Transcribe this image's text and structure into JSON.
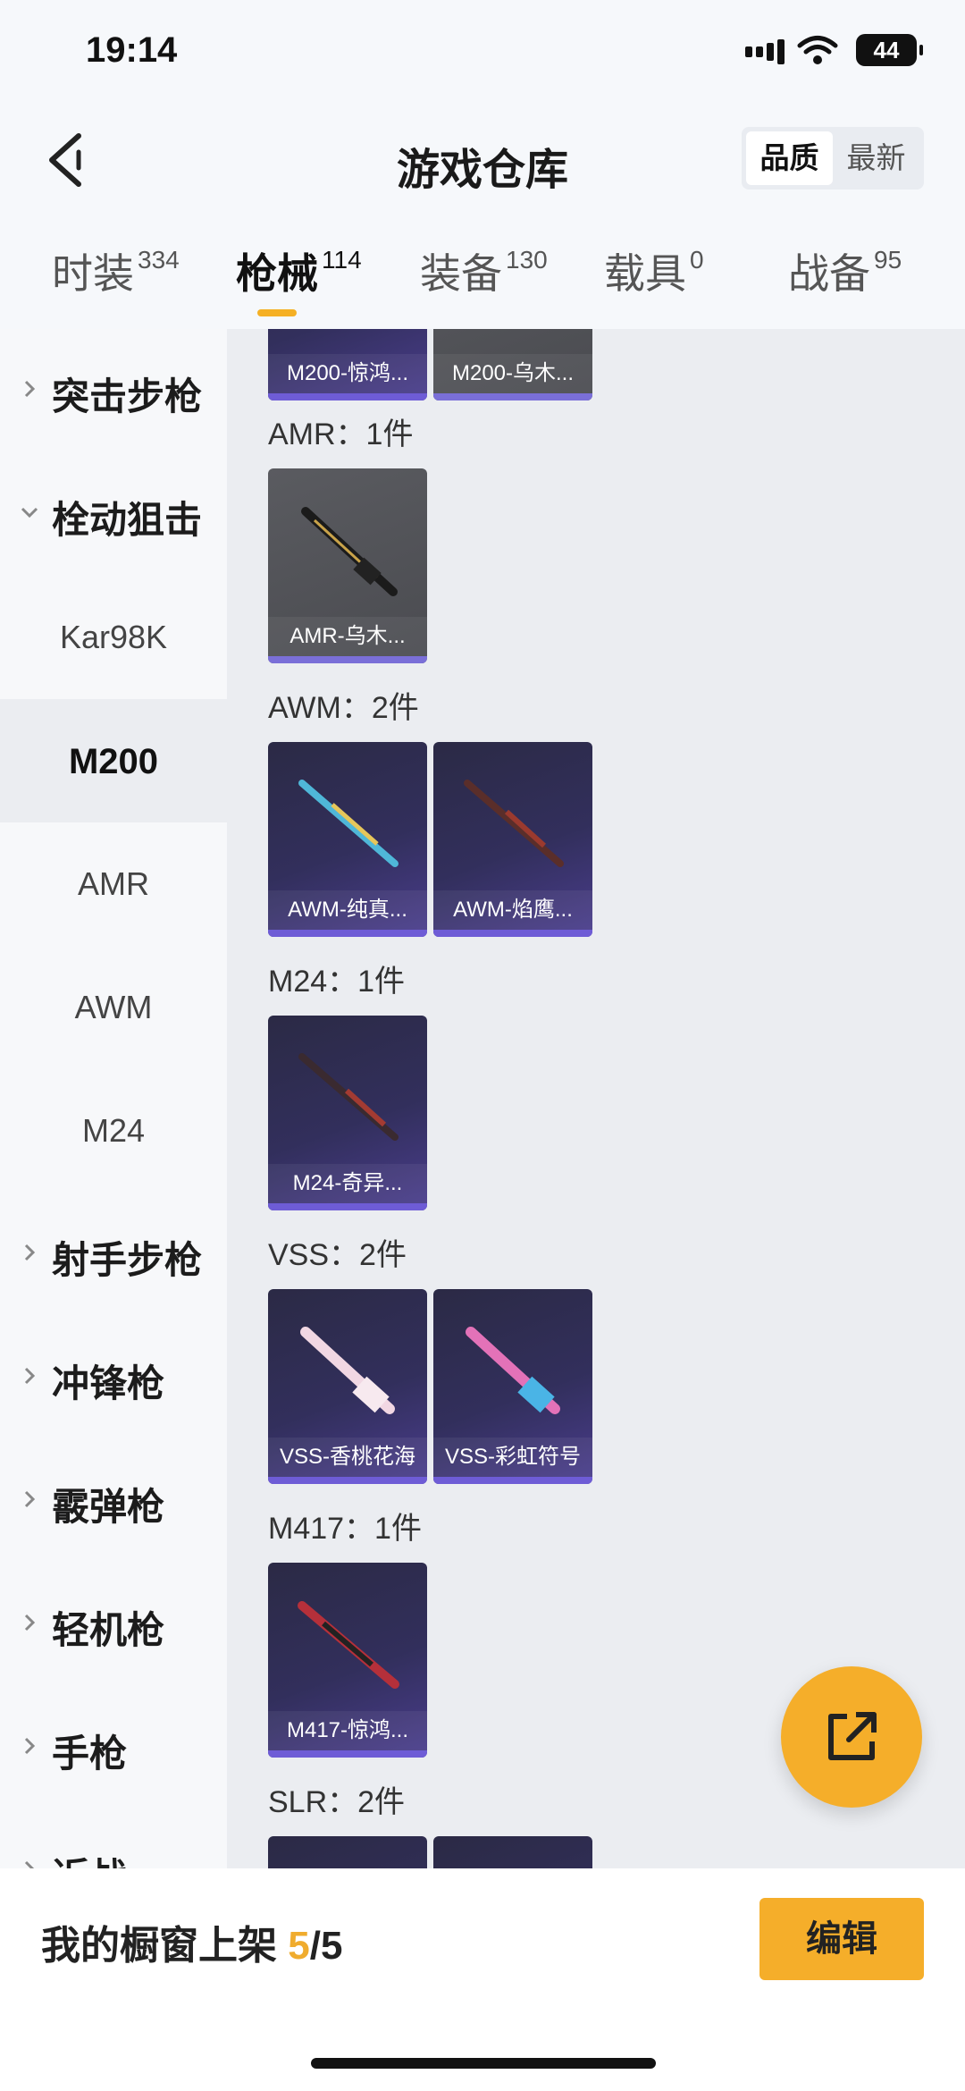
{
  "status": {
    "time": "19:14",
    "battery": "44"
  },
  "header": {
    "title": "游戏仓库",
    "sort_quality": "品质",
    "sort_newest": "最新"
  },
  "tabs": [
    {
      "label": "时装",
      "count": "334"
    },
    {
      "label": "枪械",
      "count": "114"
    },
    {
      "label": "装备",
      "count": "130"
    },
    {
      "label": "载具",
      "count": "0"
    },
    {
      "label": "战备",
      "count": "95"
    }
  ],
  "sidebar": {
    "categories": [
      "突击步枪",
      "栓动狙击",
      "射手步枪",
      "冲锋枪",
      "霰弹枪",
      "轻机枪",
      "手枪",
      "近战"
    ],
    "subitems": [
      "Kar98K",
      "M200",
      "AMR",
      "AWM",
      "M24"
    ]
  },
  "sections": [
    {
      "title": "AMR：1件",
      "items": [
        "AMR-乌木..."
      ]
    },
    {
      "title": "AWM：2件",
      "items": [
        "AWM-纯真...",
        "AWM-焰鹰..."
      ]
    },
    {
      "title": "M24：1件",
      "items": [
        "M24-奇异..."
      ]
    },
    {
      "title": "VSS：2件",
      "items": [
        "VSS-香桃花海",
        "VSS-彩虹符号"
      ]
    },
    {
      "title": "M417：1件",
      "items": [
        "M417-惊鸿..."
      ]
    },
    {
      "title": "SLR：2件",
      "items": []
    }
  ],
  "top_partial": [
    "M200-惊鸿...",
    "M200-乌木..."
  ],
  "bottom": {
    "label": "我的橱窗上架 ",
    "count": "5",
    "total": "/5",
    "edit": "编辑"
  }
}
